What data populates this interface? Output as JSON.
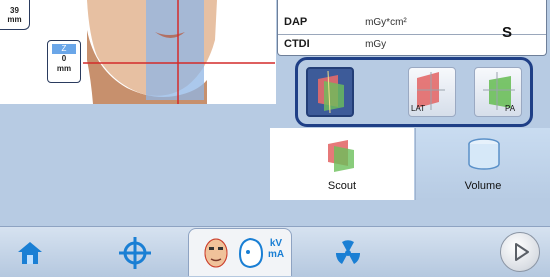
{
  "viewer": {
    "mm_top_value": "39",
    "mm_top_unit": "mm",
    "z_axis_label": "Z",
    "z_value": "0",
    "z_unit": "mm"
  },
  "dose_info": {
    "dap_label": "DAP",
    "dap_unit": "mGy*cm²",
    "ctdi_label": "CTDI",
    "ctdi_unit": "mGy",
    "size_code": "S"
  },
  "scan_modes": {
    "lat_label": "LAT",
    "pa_label": "PA"
  },
  "tabs": {
    "scout_label": "Scout",
    "volume_label": "Volume"
  },
  "bottom_nav": {
    "kv_label": "kV",
    "ma_label": "mA"
  },
  "colors": {
    "selection_border": "#1f3f86",
    "selected_button": "#3d5b99",
    "panel_background": "#b7cbe3",
    "guide_line": "#d42a2a"
  }
}
